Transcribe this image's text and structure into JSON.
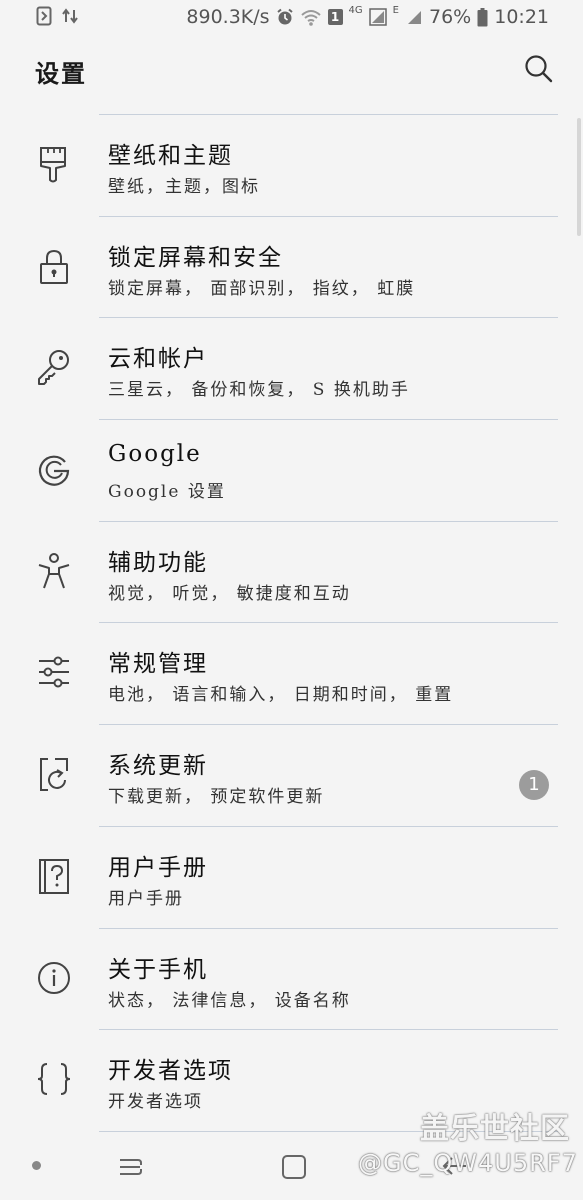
{
  "status_bar": {
    "speed": "890.3K/s",
    "notification_count": "1",
    "network_4g": "4G",
    "network_e": "E",
    "battery": "76%",
    "time": "10:21"
  },
  "header": {
    "title": "设置",
    "search_icon": "search-icon"
  },
  "settings": [
    {
      "icon": "paint-brush-icon",
      "title": "壁纸和主题",
      "subtitle": "壁纸，主题，图标"
    },
    {
      "icon": "lock-icon",
      "title": "锁定屏幕和安全",
      "subtitle": "锁定屏幕， 面部识别， 指纹， 虹膜"
    },
    {
      "icon": "key-icon",
      "title": "云和帐户",
      "subtitle": "三星云， 备份和恢复， S 换机助手"
    },
    {
      "icon": "google-icon",
      "title": "Google",
      "subtitle": "Google 设置"
    },
    {
      "icon": "accessibility-icon",
      "title": "辅助功能",
      "subtitle": "视觉， 听觉， 敏捷度和互动"
    },
    {
      "icon": "sliders-icon",
      "title": "常规管理",
      "subtitle": "电池， 语言和输入， 日期和时间， 重置"
    },
    {
      "icon": "software-update-icon",
      "title": "系统更新",
      "subtitle": "下载更新， 预定软件更新",
      "badge": "1"
    },
    {
      "icon": "user-manual-icon",
      "title": "用户手册",
      "subtitle": "用户手册"
    },
    {
      "icon": "info-icon",
      "title": "关于手机",
      "subtitle": "状态， 法律信息， 设备名称"
    },
    {
      "icon": "developer-options-icon",
      "title": "开发者选项",
      "subtitle": "开发者选项"
    }
  ],
  "nav_bar": {
    "recents_icon": "recents-icon",
    "home_icon": "home-icon",
    "back_icon": "back-icon"
  },
  "watermark": {
    "title": "盖乐世社区",
    "handle": "@GC_QW4U5RF7"
  },
  "colors": {
    "background": "#f4f4f4",
    "divider": "#c8d0db",
    "badge": "#9c9c9c",
    "text": "#1a1a1a"
  }
}
